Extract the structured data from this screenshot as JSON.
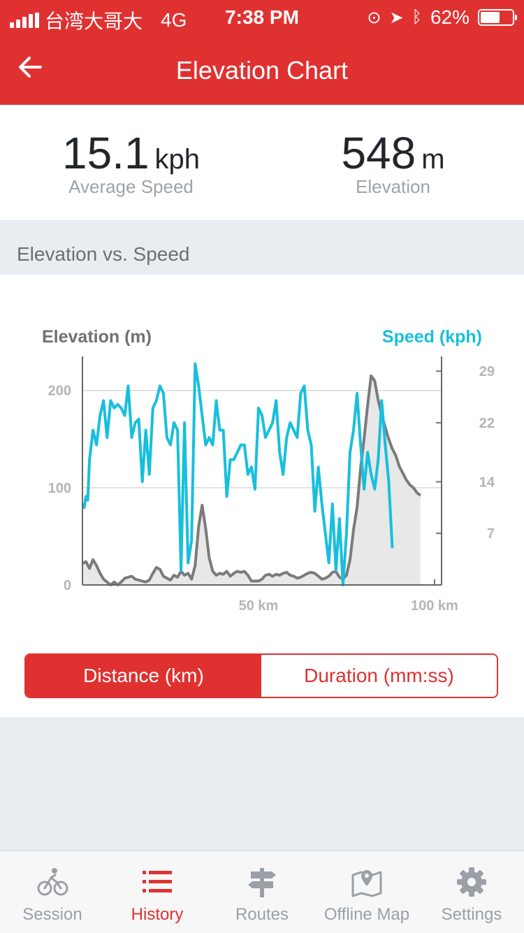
{
  "status_bar": {
    "carrier": "台湾大哥大",
    "network": "4G",
    "time": "7:38 PM",
    "battery": "62%",
    "battery_level": 0.62
  },
  "header": {
    "title": "Elevation Chart",
    "back_icon": "arrow-left-icon"
  },
  "stats": {
    "speed": {
      "value": "15.1",
      "unit": "kph",
      "label": "Average Speed"
    },
    "elevation": {
      "value": "548",
      "unit": "m",
      "label": "Elevation"
    }
  },
  "section": {
    "title": "Elevation vs. Speed"
  },
  "chart_data": {
    "type": "line",
    "left_axis_title": "Elevation (m)",
    "right_axis_title": "Speed (kph)",
    "x_tick_labels": [
      "50 km",
      "100 km"
    ],
    "x_ticks": [
      50,
      100
    ],
    "left_tick_labels": [
      "0",
      "100",
      "200"
    ],
    "left_ticks": [
      0,
      100,
      200
    ],
    "right_tick_labels": [
      "7",
      "14",
      "22",
      "29"
    ],
    "right_ticks": [
      7,
      14,
      22,
      29
    ],
    "xlim": [
      0,
      102
    ],
    "ylim_left": [
      0,
      235
    ],
    "ylim_right": [
      0,
      31
    ],
    "colors": {
      "elevation": "#7b7b7b",
      "speed": "#18bfdc"
    },
    "series": [
      {
        "axis": "left",
        "area": true,
        "points": [
          [
            0,
            22
          ],
          [
            1,
            24
          ],
          [
            2,
            17
          ],
          [
            3,
            26
          ],
          [
            4,
            20
          ],
          [
            5,
            12
          ],
          [
            6,
            6
          ],
          [
            7,
            3
          ],
          [
            8,
            0
          ],
          [
            9,
            3
          ],
          [
            10,
            0
          ],
          [
            11,
            3
          ],
          [
            12,
            7
          ],
          [
            13,
            8
          ],
          [
            14,
            9
          ],
          [
            15,
            6
          ],
          [
            16,
            5
          ],
          [
            17,
            4
          ],
          [
            18,
            3
          ],
          [
            19,
            5
          ],
          [
            20,
            12
          ],
          [
            21,
            18
          ],
          [
            22,
            16
          ],
          [
            23,
            9
          ],
          [
            24,
            7
          ],
          [
            25,
            5
          ],
          [
            26,
            10
          ],
          [
            27,
            8
          ],
          [
            28,
            14
          ],
          [
            29,
            10
          ],
          [
            30,
            12
          ],
          [
            31,
            6
          ],
          [
            32,
            20
          ],
          [
            33,
            60
          ],
          [
            34,
            82
          ],
          [
            35,
            58
          ],
          [
            36,
            28
          ],
          [
            37,
            14
          ],
          [
            38,
            10
          ],
          [
            39,
            12
          ],
          [
            40,
            11
          ],
          [
            41,
            14
          ],
          [
            42,
            9
          ],
          [
            43,
            12
          ],
          [
            44,
            14
          ],
          [
            45,
            13
          ],
          [
            46,
            14
          ],
          [
            47,
            10
          ],
          [
            48,
            4
          ],
          [
            49,
            4
          ],
          [
            50,
            4
          ],
          [
            51,
            6
          ],
          [
            52,
            10
          ],
          [
            53,
            11
          ],
          [
            54,
            9
          ],
          [
            55,
            11
          ],
          [
            56,
            10
          ],
          [
            57,
            12
          ],
          [
            58,
            13
          ],
          [
            59,
            10
          ],
          [
            60,
            9
          ],
          [
            61,
            7
          ],
          [
            62,
            8
          ],
          [
            63,
            10
          ],
          [
            64,
            12
          ],
          [
            65,
            13
          ],
          [
            66,
            12
          ],
          [
            67,
            9
          ],
          [
            68,
            6
          ],
          [
            69,
            7
          ],
          [
            70,
            9
          ],
          [
            71,
            13
          ],
          [
            72,
            14
          ],
          [
            73,
            8
          ],
          [
            74,
            6
          ],
          [
            75,
            10
          ],
          [
            76,
            26
          ],
          [
            77,
            57
          ],
          [
            78,
            80
          ],
          [
            79,
            120
          ],
          [
            80,
            150
          ],
          [
            81,
            185
          ],
          [
            82,
            215
          ],
          [
            83,
            210
          ],
          [
            84,
            190
          ],
          [
            85,
            175
          ],
          [
            86,
            162
          ],
          [
            87,
            150
          ],
          [
            88,
            140
          ],
          [
            89,
            133
          ],
          [
            90,
            122
          ],
          [
            91,
            115
          ],
          [
            92,
            108
          ],
          [
            93,
            103
          ],
          [
            94,
            100
          ],
          [
            95,
            95
          ],
          [
            96,
            92
          ]
        ]
      },
      {
        "axis": "right",
        "area": false,
        "points": [
          [
            0,
            11
          ],
          [
            0.5,
            10.5
          ],
          [
            1,
            12
          ],
          [
            1.5,
            11.5
          ],
          [
            2,
            17
          ],
          [
            3,
            21
          ],
          [
            4,
            19
          ],
          [
            5,
            23
          ],
          [
            6,
            25
          ],
          [
            7,
            20
          ],
          [
            8,
            25
          ],
          [
            9,
            24
          ],
          [
            10,
            24.5
          ],
          [
            11,
            24
          ],
          [
            12,
            23
          ],
          [
            13,
            27
          ],
          [
            14,
            20
          ],
          [
            15,
            22
          ],
          [
            16,
            22.5
          ],
          [
            17,
            14
          ],
          [
            18,
            21
          ],
          [
            19,
            15
          ],
          [
            20,
            24
          ],
          [
            21,
            25
          ],
          [
            22,
            27
          ],
          [
            23,
            26
          ],
          [
            24,
            20
          ],
          [
            25,
            19
          ],
          [
            26,
            22
          ],
          [
            27,
            21
          ],
          [
            28,
            2
          ],
          [
            29,
            22
          ],
          [
            30,
            3
          ],
          [
            31,
            6
          ],
          [
            32,
            30
          ],
          [
            33,
            27
          ],
          [
            34,
            23
          ],
          [
            35,
            19
          ],
          [
            36,
            20
          ],
          [
            37,
            19
          ],
          [
            38,
            25
          ],
          [
            39,
            21
          ],
          [
            40,
            21
          ],
          [
            41,
            12
          ],
          [
            42,
            17
          ],
          [
            43,
            17
          ],
          [
            44,
            18
          ],
          [
            45,
            19
          ],
          [
            46,
            19
          ],
          [
            47,
            15
          ],
          [
            48,
            16
          ],
          [
            49,
            13
          ],
          [
            50,
            24
          ],
          [
            51,
            23
          ],
          [
            52,
            20
          ],
          [
            53,
            21
          ],
          [
            54,
            22
          ],
          [
            55,
            25
          ],
          [
            56,
            18
          ],
          [
            57,
            15
          ],
          [
            58,
            20
          ],
          [
            59,
            22
          ],
          [
            60,
            21
          ],
          [
            61,
            20
          ],
          [
            62,
            26
          ],
          [
            63,
            27
          ],
          [
            64,
            21
          ],
          [
            65,
            19
          ],
          [
            66,
            10
          ],
          [
            67,
            16
          ],
          [
            68,
            11
          ],
          [
            69,
            7
          ],
          [
            70,
            3
          ],
          [
            71,
            11
          ],
          [
            72,
            2
          ],
          [
            73,
            9
          ],
          [
            74,
            0
          ],
          [
            75,
            7
          ],
          [
            76,
            18
          ],
          [
            77,
            21
          ],
          [
            78,
            26
          ],
          [
            79,
            19
          ],
          [
            80,
            13
          ],
          [
            81,
            18
          ],
          [
            82,
            15
          ],
          [
            83,
            13
          ],
          [
            84,
            17
          ],
          [
            85,
            25
          ],
          [
            86,
            19
          ],
          [
            87,
            14
          ],
          [
            88,
            5
          ]
        ]
      }
    ]
  },
  "toggle": {
    "distance_label": "Distance (km)",
    "duration_label": "Duration (mm:ss)"
  },
  "tabs": [
    {
      "label": "Session",
      "icon": "cyclist-icon"
    },
    {
      "label": "History",
      "icon": "list-icon"
    },
    {
      "label": "Routes",
      "icon": "signpost-icon"
    },
    {
      "label": "Offline Map",
      "icon": "map-pin-icon"
    },
    {
      "label": "Settings",
      "icon": "gear-icon"
    }
  ]
}
